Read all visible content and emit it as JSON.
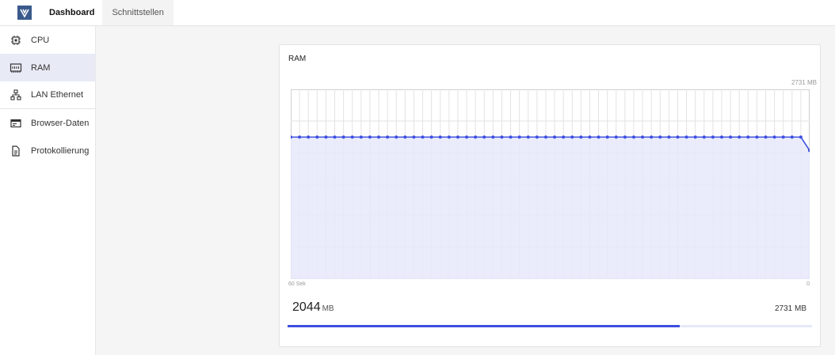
{
  "header": {
    "tabs": [
      {
        "label": "Dashboard",
        "active": true
      },
      {
        "label": "Schnittstellen",
        "active": false
      }
    ]
  },
  "sidebar": {
    "items": [
      {
        "label": "CPU",
        "icon": "cpu-icon"
      },
      {
        "label": "RAM",
        "icon": "memory-icon",
        "active": true
      },
      {
        "label": "LAN Ethernet",
        "icon": "network-icon"
      },
      {
        "label": "Browser-Daten",
        "icon": "browser-icon"
      },
      {
        "label": "Protokollierung",
        "icon": "document-icon"
      }
    ]
  },
  "card": {
    "title": "RAM",
    "max_label": "2731 MB",
    "x_start_label": "60 Sek",
    "x_end_label": "0",
    "used_value": "2044",
    "used_unit": "MB",
    "total_label": "2731 MB",
    "usage_fraction": 0.748
  },
  "colors": {
    "accent": "#3d4fe0",
    "fill": "#e6e9fb",
    "active_bg": "#e8eaf6"
  },
  "chart_data": {
    "type": "area",
    "ylim": [
      0,
      2731
    ],
    "xlim": [
      60,
      0
    ],
    "series": [
      {
        "values": [
          2044,
          2044,
          2044,
          2044,
          2044,
          2044,
          2044,
          2044,
          2044,
          2044,
          2044,
          2044,
          2044,
          2044,
          2044,
          2044,
          2044,
          2044,
          2044,
          2044,
          2044,
          2044,
          2044,
          2044,
          2044,
          2044,
          2044,
          2044,
          2044,
          2044,
          2044,
          2044,
          2044,
          2044,
          2044,
          2044,
          2044,
          2044,
          2044,
          2044,
          2044,
          2044,
          2044,
          2044,
          2044,
          2044,
          2044,
          2044,
          2044,
          2044,
          2044,
          2044,
          2044,
          2044,
          2044,
          2044,
          2044,
          2044,
          2044,
          1850
        ]
      }
    ],
    "grid": true
  }
}
